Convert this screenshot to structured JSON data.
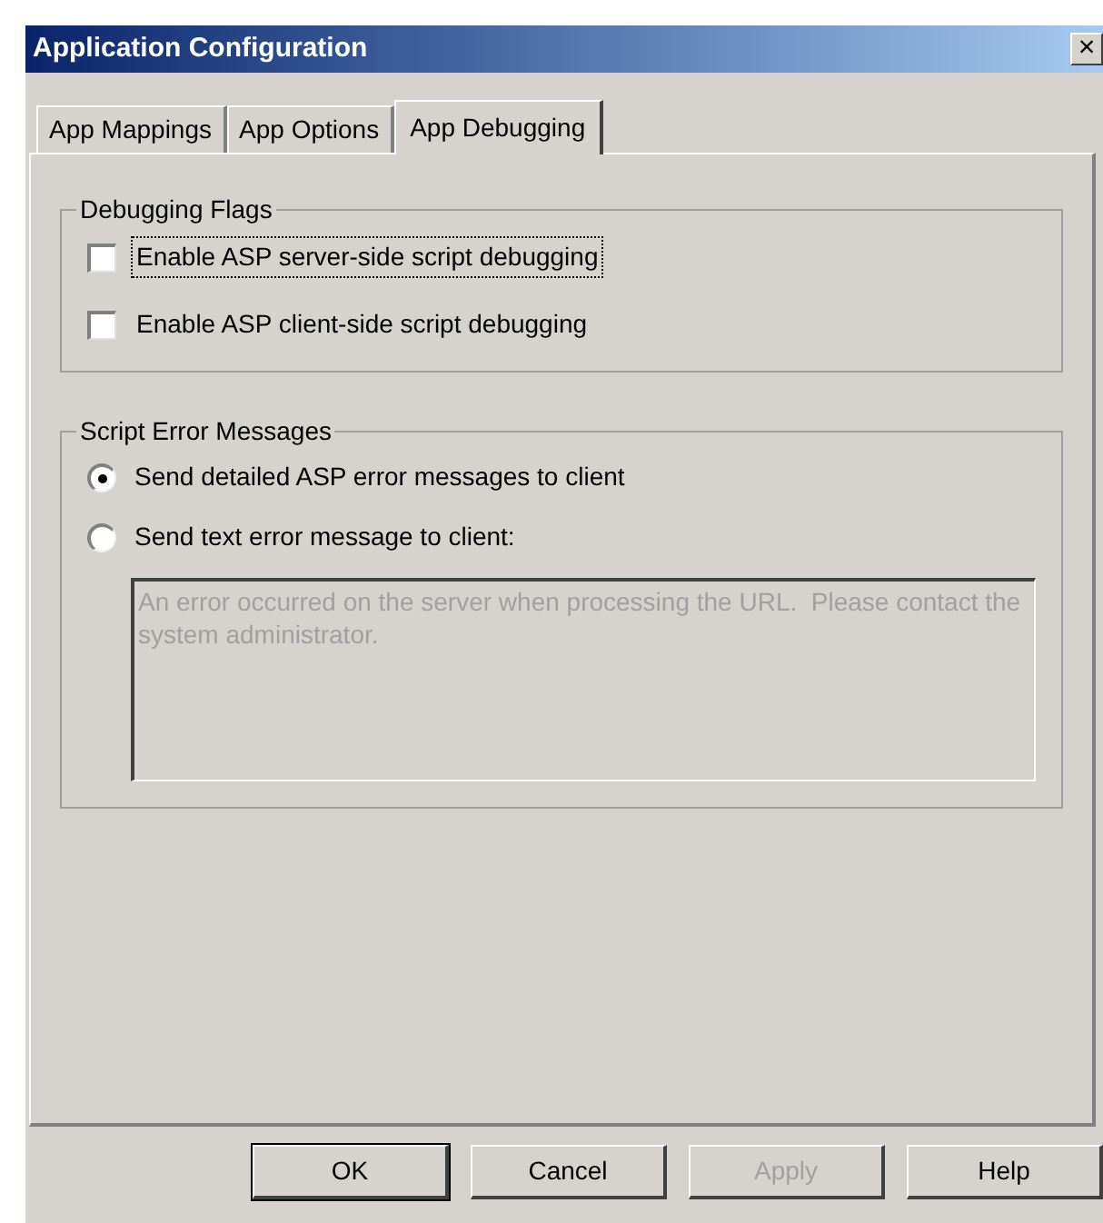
{
  "window": {
    "title": "Application Configuration",
    "close": "×"
  },
  "tabs": [
    {
      "label": "App Mappings",
      "selected": false
    },
    {
      "label": "App Options",
      "selected": false
    },
    {
      "label": "App Debugging",
      "selected": true
    }
  ],
  "debugging_flags": {
    "title": "Debugging Flags",
    "items": [
      {
        "label": "Enable ASP server-side script debugging",
        "checked": false,
        "focused": true
      },
      {
        "label": "Enable ASP client-side script debugging",
        "checked": false,
        "focused": false
      }
    ]
  },
  "script_error_messages": {
    "title": "Script Error Messages",
    "options": [
      {
        "label": "Send detailed ASP error messages to client",
        "selected": true
      },
      {
        "label": "Send text error message to client:",
        "selected": false
      }
    ],
    "message": {
      "value": "An error occurred on the server when processing the URL.  Please contact the system administrator.",
      "disabled": true
    }
  },
  "buttons": [
    {
      "label": "OK",
      "default": true,
      "disabled": false
    },
    {
      "label": "Cancel",
      "default": false,
      "disabled": false
    },
    {
      "label": "Apply",
      "default": false,
      "disabled": true
    },
    {
      "label": "Help",
      "default": false,
      "disabled": false
    }
  ]
}
